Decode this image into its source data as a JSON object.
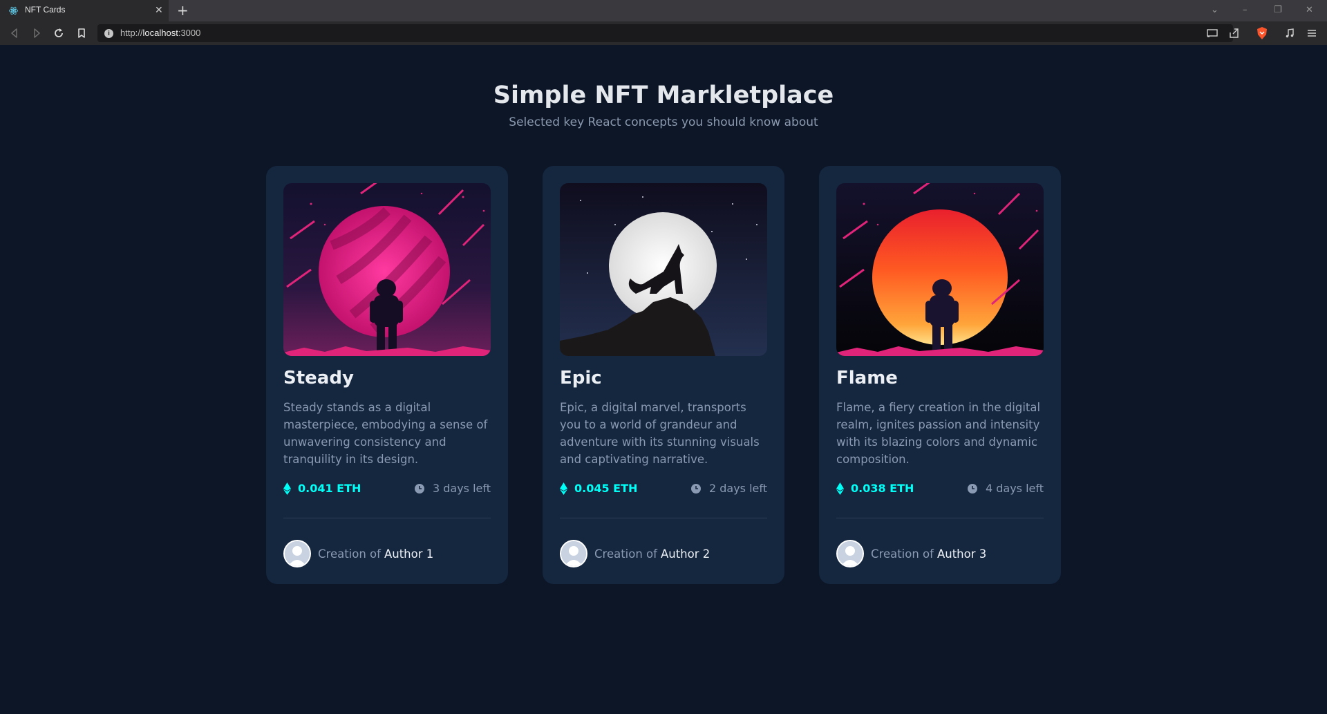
{
  "browser": {
    "tab_title": "NFT Cards",
    "tab_close": "✕",
    "new_tab": "+",
    "url_scheme": "http://",
    "url_host": "localhost",
    "url_port": ":3000",
    "window_controls": [
      "⌄",
      "–",
      "❐",
      "✕"
    ]
  },
  "page": {
    "title": "Simple NFT Markletplace",
    "subtitle": "Selected key React concepts you should know about"
  },
  "cards": [
    {
      "name": "Steady",
      "description": "Steady stands as a digital masterpiece, embodying a sense of unwavering consistency and tranquility in its design.",
      "price": "0.041 ETH",
      "time_left": "3 days left",
      "creation_label": "Creation of",
      "author": "Author 1",
      "image": "astronaut-pink-planet"
    },
    {
      "name": "Epic",
      "description": "Epic, a digital marvel, transports you to a world of grandeur and adventure with its stunning visuals and captivating narrative.",
      "price": "0.045 ETH",
      "time_left": "2 days left",
      "creation_label": "Creation of",
      "author": "Author 2",
      "image": "wolf-howling-moon"
    },
    {
      "name": "Flame",
      "description": "Flame, a fiery creation in the digital realm, ignites passion and intensity with its blazing colors and dynamic composition.",
      "price": "0.038 ETH",
      "time_left": "4 days left",
      "creation_label": "Creation of",
      "author": "Author 3",
      "image": "astronaut-orange-sun"
    }
  ],
  "colors": {
    "background": "#0c1627",
    "card": "#15263f",
    "accent_cyan": "#00fff7",
    "muted_text": "#8a9ab3"
  }
}
